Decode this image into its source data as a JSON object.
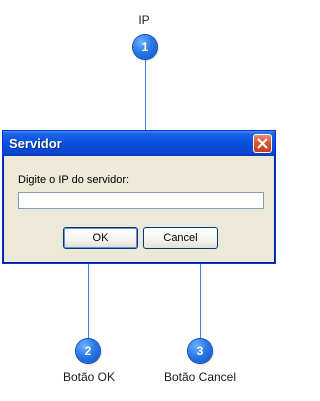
{
  "callouts": [
    {
      "number": "1",
      "label": "IP"
    },
    {
      "number": "2",
      "label": "Botão OK"
    },
    {
      "number": "3",
      "label": "Botão Cancel"
    }
  ],
  "dialog": {
    "title": "Servidor",
    "prompt": "Digite o IP do servidor:",
    "ip_value": "",
    "ok_label": "OK",
    "cancel_label": "Cancel"
  },
  "colors": {
    "titlebar": "#0a4fdb",
    "window_face": "#ece9d8",
    "badge": "#2a7ae8",
    "connector_line": "#3d86e0",
    "close_button": "#d9542e"
  },
  "icons": {
    "close": "close-icon"
  }
}
